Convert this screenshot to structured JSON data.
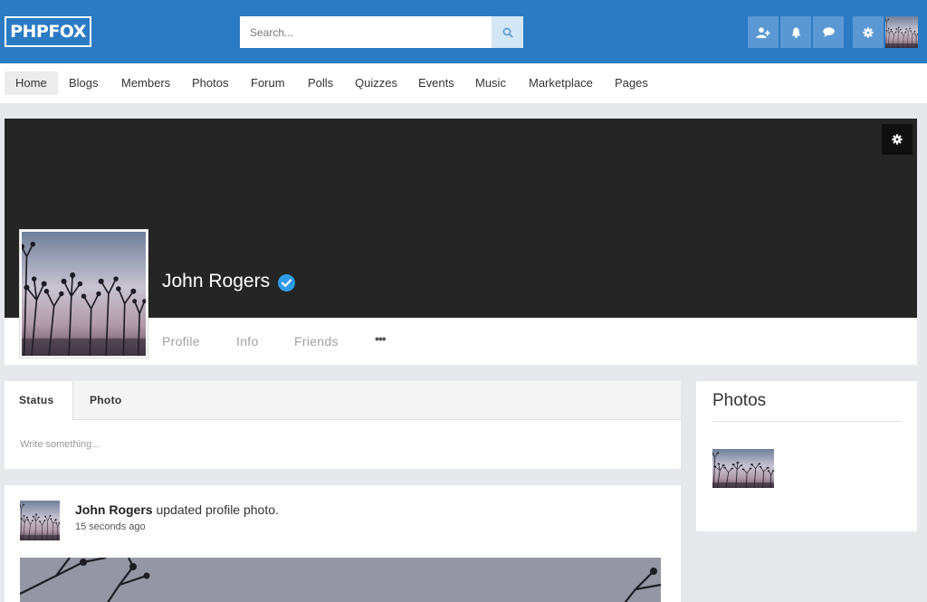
{
  "header": {
    "logo": "PHPFOX",
    "search_placeholder": "Search...",
    "icons": [
      "search-icon",
      "add-friend-icon",
      "bell-icon",
      "chat-icon",
      "gear-icon"
    ],
    "accent": "#2b7bc4"
  },
  "nav": {
    "items": [
      {
        "label": "Home",
        "active": true
      },
      {
        "label": "Blogs"
      },
      {
        "label": "Members"
      },
      {
        "label": "Photos"
      },
      {
        "label": "Forum"
      },
      {
        "label": "Polls"
      },
      {
        "label": "Quizzes"
      },
      {
        "label": "Events"
      },
      {
        "label": "Music"
      },
      {
        "label": "Marketplace"
      },
      {
        "label": "Pages"
      }
    ]
  },
  "profile": {
    "name": "John Rogers",
    "verified": true,
    "tabs": [
      "Profile",
      "Info",
      "Friends"
    ],
    "more": "•••"
  },
  "composer": {
    "tabs": [
      "Status",
      "Photo"
    ],
    "active_tab": "Status",
    "placeholder": "Write something..."
  },
  "feed": {
    "items": [
      {
        "author": "John Rogers",
        "action": " updated profile photo.",
        "time": "15 seconds ago"
      }
    ]
  },
  "photos_widget": {
    "title": "Photos"
  }
}
